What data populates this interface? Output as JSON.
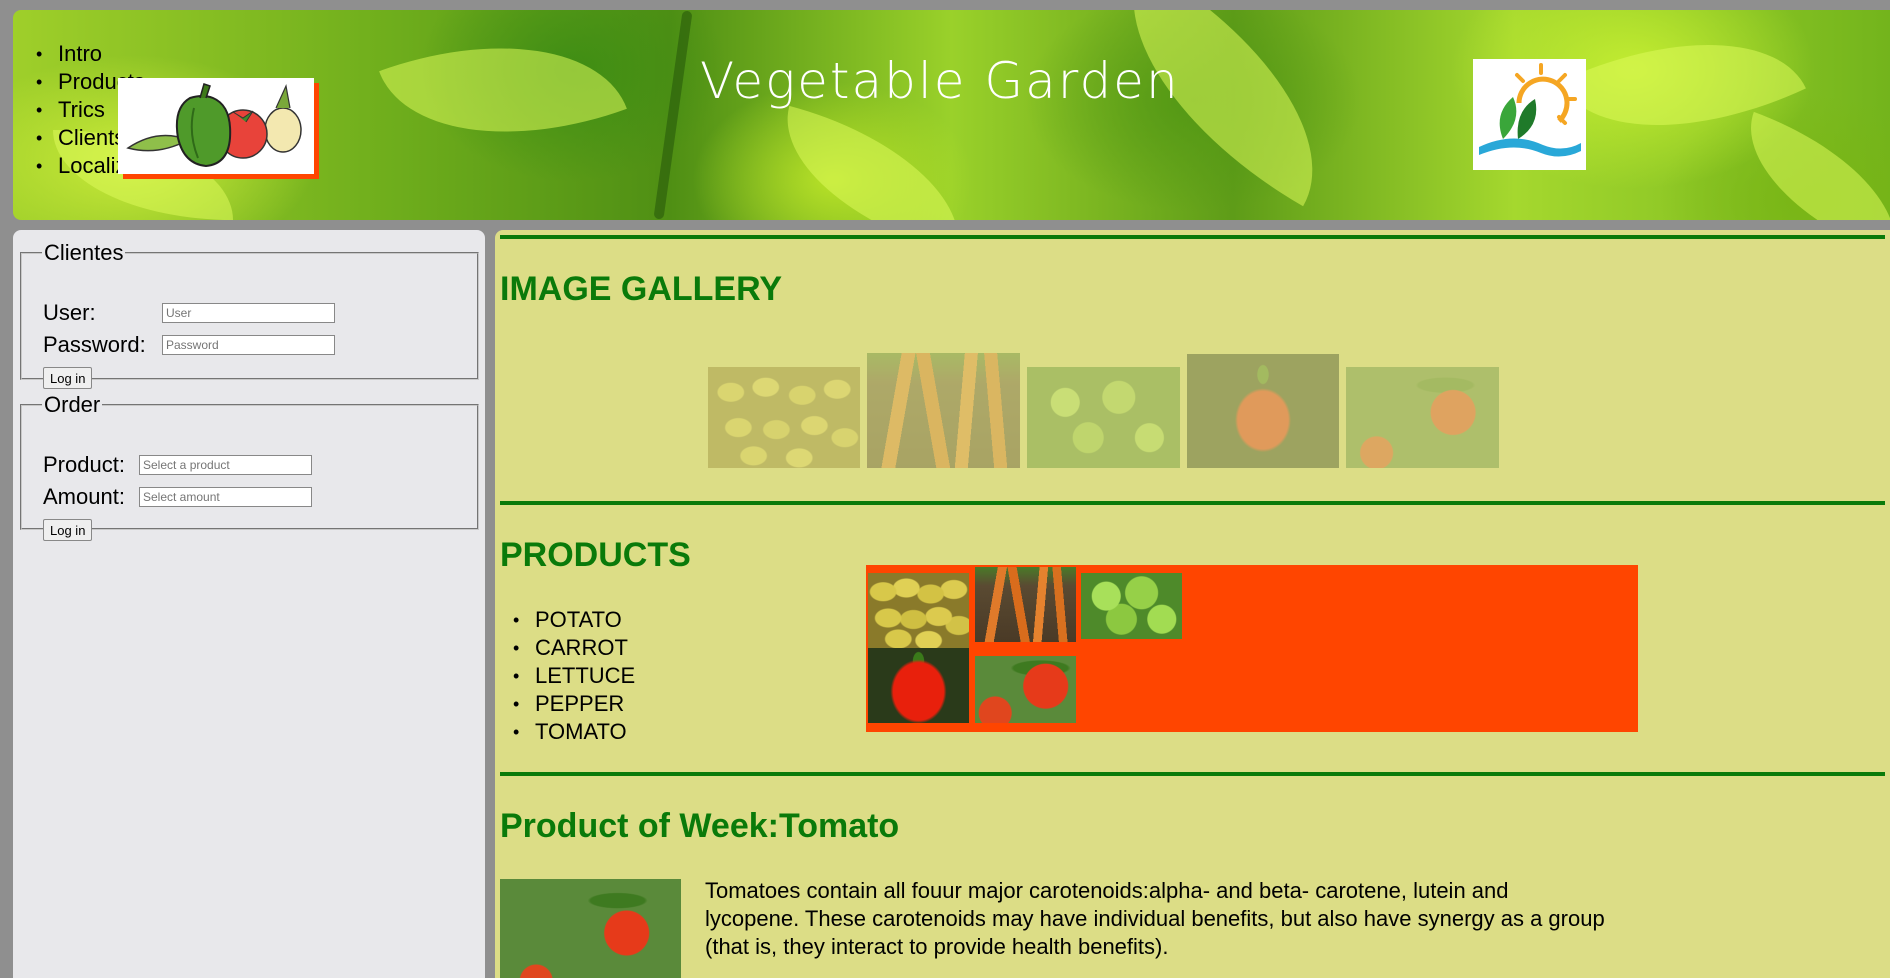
{
  "header": {
    "nav": [
      "Intro",
      "Products",
      "Trics",
      "Clients",
      "Localization"
    ],
    "title": "Vegetable Garden"
  },
  "sidebar": {
    "clientes": {
      "legend": "Clientes",
      "user_label": "User:",
      "user_placeholder": "User",
      "password_label": "Password:",
      "password_placeholder": "Password",
      "button": "Log in"
    },
    "order": {
      "legend": "Order",
      "product_label": "Product:",
      "product_placeholder": "Select a product",
      "amount_label": "Amount:",
      "amount_placeholder": "Select amount",
      "button": "Log in"
    }
  },
  "main": {
    "gallery_title": "IMAGE GALLERY",
    "products_title": "PRODUCTS",
    "products": [
      "POTATO",
      "CARROT",
      "LETTUCE",
      "PEPPER",
      "TOMATO"
    ],
    "week_title": "Product of Week:Tomato",
    "week_text": "Tomatoes contain all fouur major carotenoids:alpha- and beta- carotene, lutein and lycopene. These carotenoids may have individual benefits, but also have synergy as a group (that is, they interact to provide health benefits)."
  },
  "colors": {
    "heading_green": "#0a7a0a",
    "main_bg": "#dcdd86",
    "accent_orange": "#ff4500"
  }
}
